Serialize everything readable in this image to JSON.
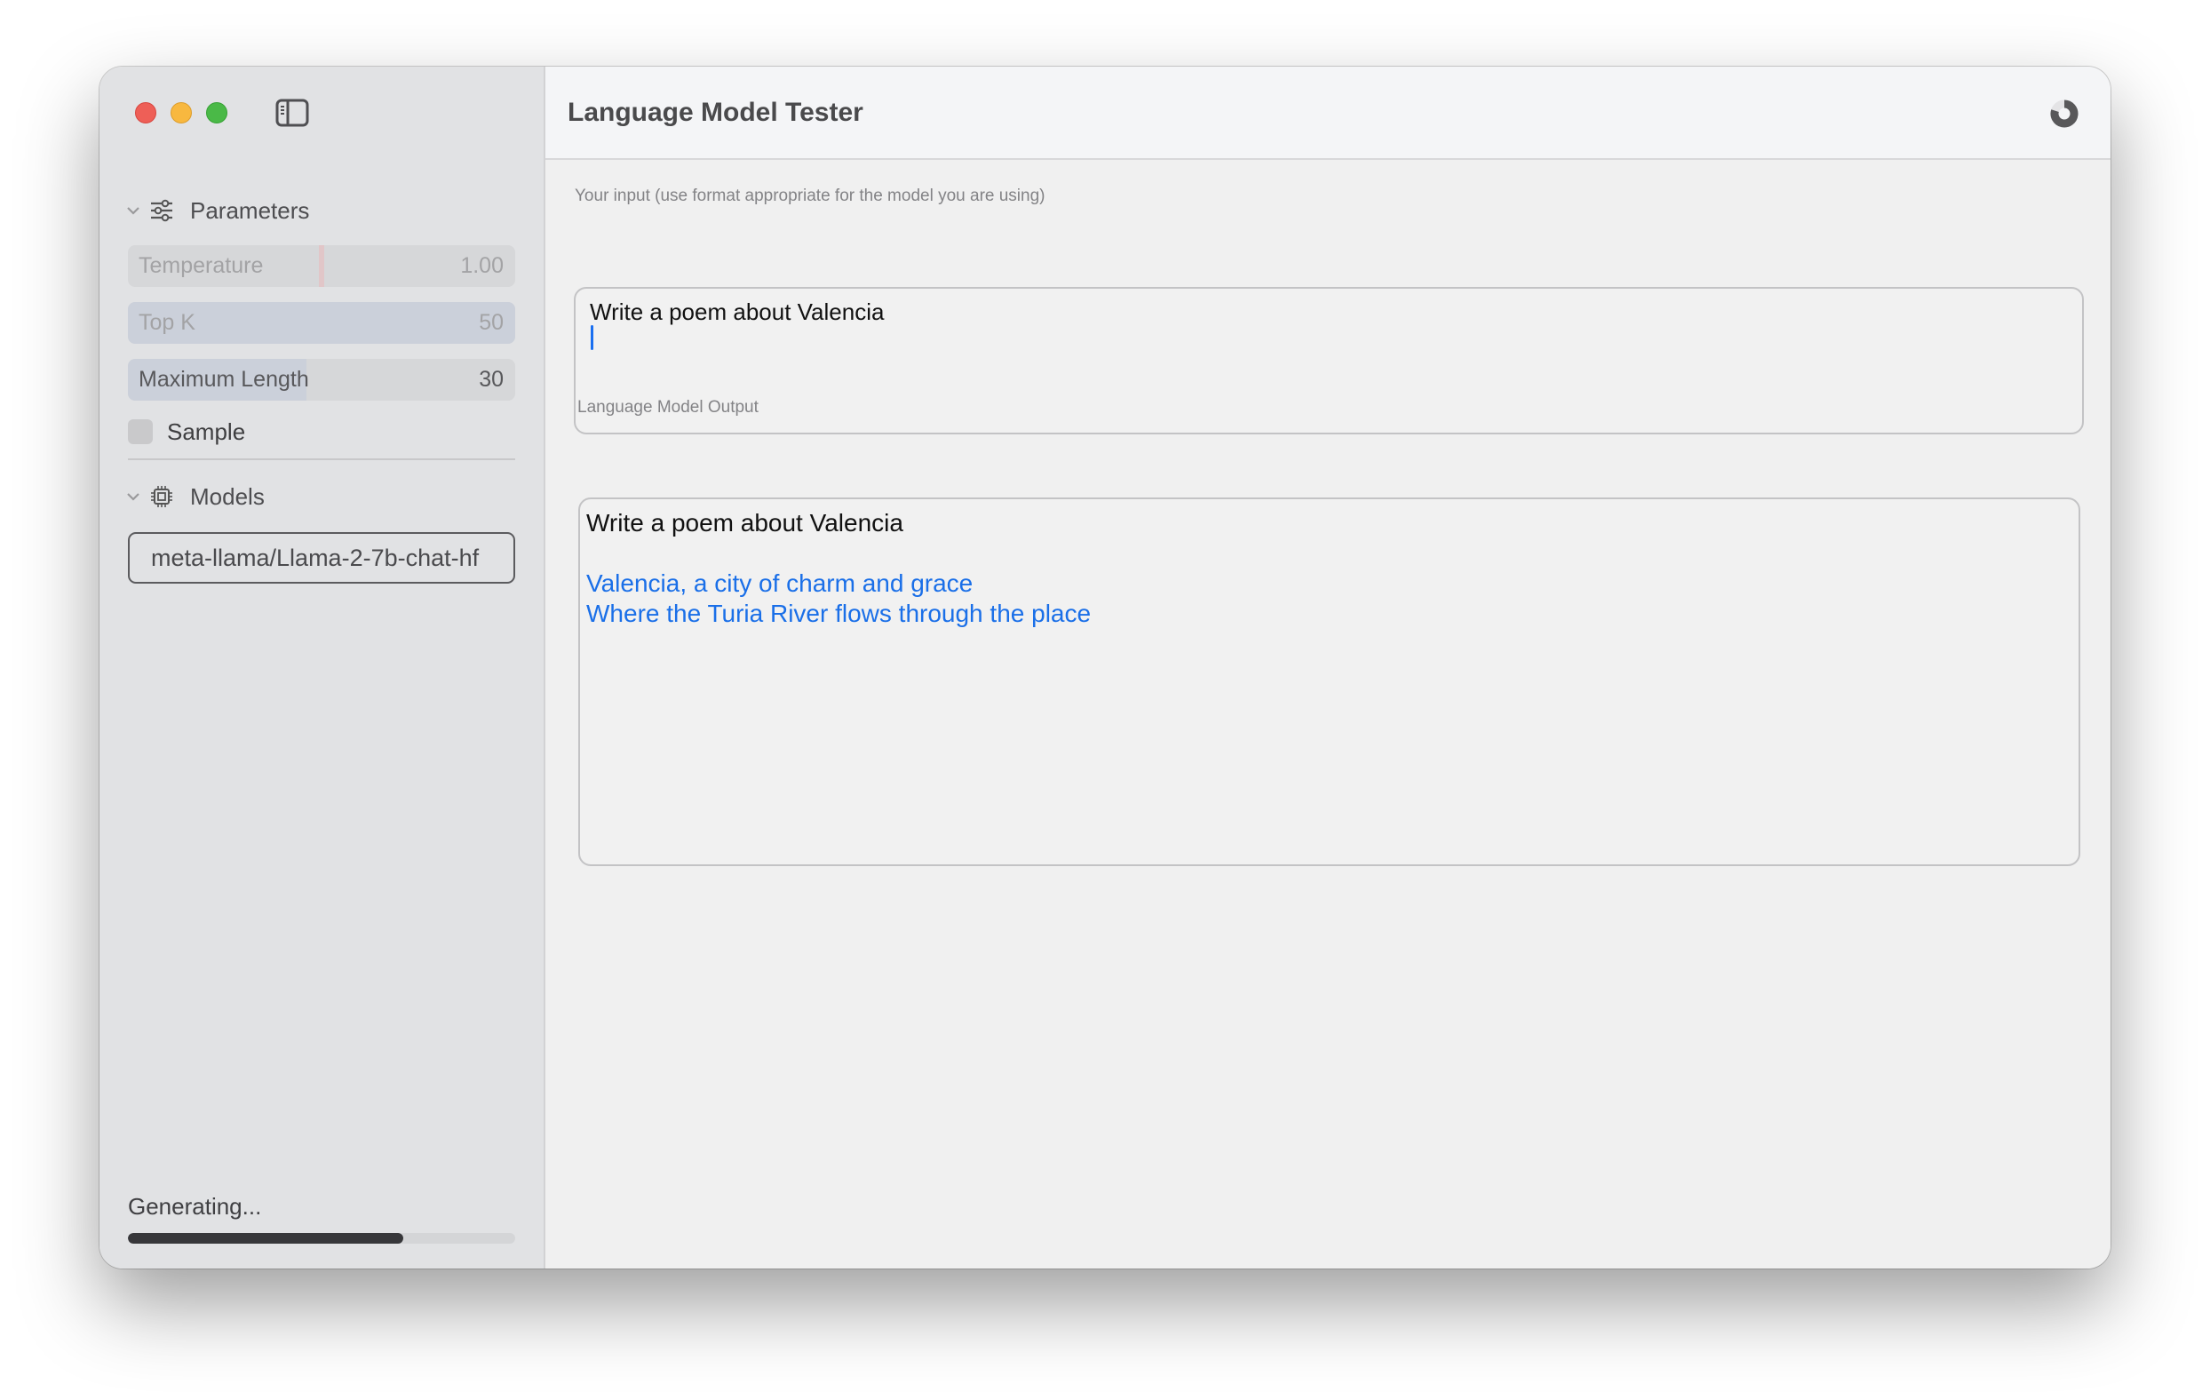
{
  "window": {
    "title": "Language Model Tester",
    "traffic_lights": [
      "close",
      "minimize",
      "zoom"
    ]
  },
  "sidebar": {
    "toggle_icon": "sidebar-left-icon",
    "parameters_section": {
      "label": "Parameters",
      "icon": "sliders-icon",
      "expanded": true,
      "sliders": [
        {
          "label": "Temperature",
          "value": "1.00",
          "enabled": false,
          "fraction": 0.5
        },
        {
          "label": "Top K",
          "value": "50",
          "enabled": false,
          "fraction": 1.0
        },
        {
          "label": "Maximum Length",
          "value": "30",
          "enabled": true,
          "fraction": 0.46
        }
      ],
      "sample_checkbox": {
        "label": "Sample",
        "checked": false
      }
    },
    "models_section": {
      "label": "Models",
      "icon": "cpu-chip-icon",
      "expanded": true,
      "selected_model": "meta-llama/Llama-2-7b-chat-hf"
    },
    "status": {
      "text": "Generating...",
      "progress": 0.71
    }
  },
  "header": {
    "title": "Language Model Tester",
    "spinner_icon": "progress-spinner-icon",
    "spinner_progress": 0.8
  },
  "main": {
    "input": {
      "label": "Your input (use format appropriate for the model you are using)",
      "value": "Write a poem about Valencia"
    },
    "output": {
      "label": "Language Model Output",
      "prompt_line": "Write a poem about Valencia",
      "generated_lines": [
        "Valencia, a city of charm and grace",
        "Where the Turia River flows through the place"
      ]
    }
  },
  "colors": {
    "accent_blue": "#1a6fe8",
    "close": "#ee5f57",
    "minimize": "#f8b83f",
    "zoom": "#4ab947",
    "progress_fill": "#37373a"
  }
}
